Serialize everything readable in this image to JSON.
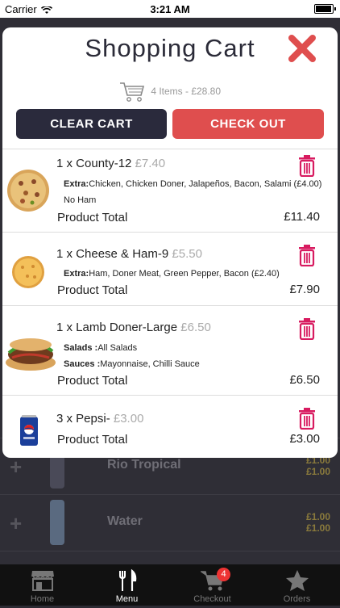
{
  "status_bar": {
    "carrier": "Carrier",
    "time": "3:21 AM"
  },
  "cart": {
    "title": "Shopping Cart",
    "summary": "4 Items - £28.80",
    "clear_label": "CLEAR CART",
    "checkout_label": "CHECK OUT",
    "product_total_label": "Product Total",
    "items": [
      {
        "name": "1 x County-12",
        "price": "£7.40",
        "details": [
          {
            "label": "Extra:",
            "text": "Chicken, Chicken Doner, Jalapeños, Bacon, Salami (£4.00)"
          },
          {
            "label": "",
            "text": "No Ham"
          }
        ],
        "total": "£11.40",
        "image": "pizza"
      },
      {
        "name": "1 x Cheese & Ham-9",
        "price": "£5.50",
        "details": [
          {
            "label": "Extra:",
            "text": "Ham, Doner Meat, Green Pepper, Bacon (£2.40)"
          }
        ],
        "total": "£7.90",
        "image": "pizza-small"
      },
      {
        "name": "1 x Lamb Doner-Large",
        "price": "£6.50",
        "details": [
          {
            "label": "Salads :",
            "text": "All Salads"
          },
          {
            "label": "Sauces :",
            "text": "Mayonnaise, Chilli Sauce"
          }
        ],
        "total": "£6.50",
        "image": "kebab"
      },
      {
        "name": "3 x Pepsi-",
        "price": "£3.00",
        "details": [],
        "total": "£3.00",
        "image": "pepsi-can"
      }
    ]
  },
  "background_menu": [
    {
      "name": "Rio Tropical",
      "price1": "£1.00",
      "price2": "£1.00"
    },
    {
      "name": "Water",
      "price1": "£1.00",
      "price2": "£1.00"
    }
  ],
  "tabbar": {
    "tabs": [
      {
        "label": "Home",
        "icon": "store-icon"
      },
      {
        "label": "Menu",
        "icon": "cutlery-icon"
      },
      {
        "label": "Checkout",
        "icon": "cart-icon"
      },
      {
        "label": "Orders",
        "icon": "star-icon"
      }
    ],
    "checkout_badge": "4"
  },
  "colors": {
    "accent_red": "#df4e4e",
    "dark_button": "#2a2a3c",
    "trash_pink": "#d81b60"
  }
}
